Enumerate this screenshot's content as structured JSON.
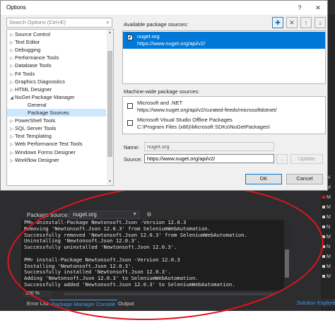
{
  "dialog": {
    "title": "Options",
    "search_placeholder": "Search Options (Ctrl+E)",
    "tree": [
      {
        "label": "Source Control",
        "expander": "▷",
        "level": 0,
        "selected": false
      },
      {
        "label": "Text Editor",
        "expander": "▷",
        "level": 0,
        "selected": false
      },
      {
        "label": "Debugging",
        "expander": "▷",
        "level": 0,
        "selected": false
      },
      {
        "label": "Performance Tools",
        "expander": "▷",
        "level": 0,
        "selected": false
      },
      {
        "label": "Database Tools",
        "expander": "▷",
        "level": 0,
        "selected": false
      },
      {
        "label": "F# Tools",
        "expander": "▷",
        "level": 0,
        "selected": false
      },
      {
        "label": "Graphics Diagnostics",
        "expander": "▷",
        "level": 0,
        "selected": false
      },
      {
        "label": "HTML Designer",
        "expander": "▷",
        "level": 0,
        "selected": false
      },
      {
        "label": "NuGet Package Manager",
        "expander": "◢",
        "level": 0,
        "selected": false
      },
      {
        "label": "General",
        "expander": "",
        "level": 1,
        "selected": false
      },
      {
        "label": "Package Sources",
        "expander": "",
        "level": 1,
        "selected": true
      },
      {
        "label": "PowerShell Tools",
        "expander": "▷",
        "level": 0,
        "selected": false
      },
      {
        "label": "SQL Server Tools",
        "expander": "▷",
        "level": 0,
        "selected": false
      },
      {
        "label": "Text Templating",
        "expander": "▷",
        "level": 0,
        "selected": false
      },
      {
        "label": "Web Performance Test Tools",
        "expander": "▷",
        "level": 0,
        "selected": false
      },
      {
        "label": "Windows Forms Designer",
        "expander": "▷",
        "level": 0,
        "selected": false
      },
      {
        "label": "Workflow Designer",
        "expander": "▷",
        "level": 0,
        "selected": false
      }
    ],
    "available_label": "Available package sources:",
    "available_sources": [
      {
        "name": "nuget.org",
        "url": "https://www.nuget.org/api/v2/",
        "checked": true,
        "selected": true
      }
    ],
    "machine_wide_label": "Machine-wide package sources:",
    "machine_wide_sources": [
      {
        "name": "Microsoft and .NET",
        "url": "https://www.nuget.org/api/v2/curated-feeds/microsoftdotnet/",
        "checked": false
      },
      {
        "name": "Microsoft Visual Studio Offline Packages",
        "url": "C:\\Program Files (x86)\\Microsoft SDKs\\NuGetPackages\\",
        "checked": false
      }
    ],
    "name_label": "Name:",
    "name_value": "nuget.org",
    "source_label": "Source:",
    "source_value": "https://www.nuget.org/api/v2/",
    "browse_label": "...",
    "update_label": "Update",
    "ok_label": "OK",
    "cancel_label": "Cancel",
    "toolbar_icons": [
      "add-icon",
      "remove-icon",
      "move-up-icon",
      "move-down-icon"
    ]
  },
  "console": {
    "package_source_label": "Package source:",
    "package_source_value": "nuget.org",
    "lines": [
      "PM> Uninstall-Package Newtonsoft.Json -Version 12.0.3",
      "Removing 'Newtonsoft.Json 12.0.3' from SeleniumWebAutomation.",
      "Successfully removed 'Newtonsoft.Json 12.0.3' from SeleniumWebAutomation.",
      "Uninstalling 'Newtonsoft.Json 12.0.3'.",
      "Successfully uninstalled 'Newtonsoft.Json 12.0.3'.",
      "",
      "PM> install-Package Newtonsoft.Json -Version 12.0.3",
      "Installing 'Newtonsoft.Json 12.0.3'.",
      "Successfully installed 'Newtonsoft.Json 12.0.3'.",
      "Adding 'Newtonsoft.Json 12.0.3' to SeleniumWebAutomation.",
      "Successfully added 'Newtonsoft.Json 12.0.3' to SeleniumWebAutomation.",
      "",
      "PM>"
    ],
    "zoom": "100 %"
  },
  "bottom_tabs": [
    "Error List",
    "Package Manager Console",
    "Output"
  ],
  "active_bottom_tab": "Package Manager Console",
  "solution_explorer_label": "Solution Explorer",
  "colors": {
    "accent": "#0078d7",
    "annotation_red": "#e0141e",
    "ide_background": "#2d2d30",
    "console_background": "#1e1e1e",
    "tab_active": "#3f9bf0"
  }
}
